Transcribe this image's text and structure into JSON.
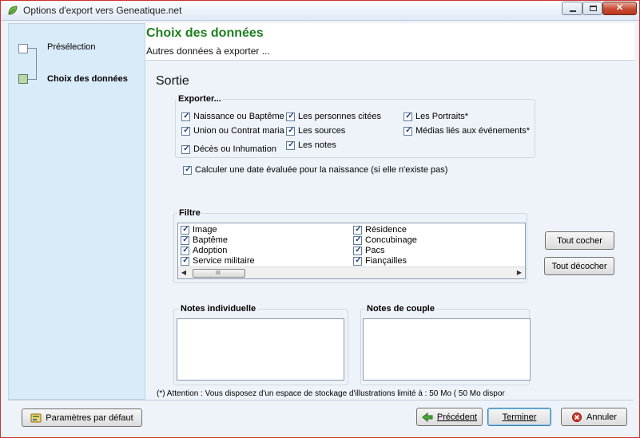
{
  "window": {
    "title": "Options d'export vers Geneatique.net",
    "controls": {
      "minimize": "minimize",
      "maximize": "maximize",
      "close": "✕"
    }
  },
  "sidebar": {
    "steps": [
      {
        "label": "Présélection",
        "active": false
      },
      {
        "label": "Choix des données",
        "active": true
      }
    ]
  },
  "header": {
    "title": "Choix des données",
    "subtitle": "Autres données à exporter ..."
  },
  "section": {
    "title": "Sortie"
  },
  "exporter": {
    "legend": "Exporter...",
    "items": [
      {
        "label": "Naissance ou Baptême",
        "checked": true
      },
      {
        "label": "Union ou Contrat maria",
        "checked": true
      },
      {
        "label": "Décès ou Inhumation",
        "checked": true
      },
      {
        "label": "Les personnes citées",
        "checked": true
      },
      {
        "label": "Les sources",
        "checked": true
      },
      {
        "label": "Les notes",
        "checked": true
      },
      {
        "label": "Les Portraits*",
        "checked": true
      },
      {
        "label": "Médias liés aux événements*",
        "checked": true
      }
    ],
    "calc_date": {
      "label": "Calculer une date évaluée pour la naissance (si elle n'existe pas)",
      "checked": true
    }
  },
  "filtre": {
    "legend": "Filtre",
    "items": [
      {
        "label": "Image",
        "checked": true
      },
      {
        "label": "Baptême",
        "checked": true
      },
      {
        "label": "Adoption",
        "checked": true
      },
      {
        "label": "Service militaire",
        "checked": true
      },
      {
        "label": "Résidence",
        "checked": true
      },
      {
        "label": "Concubinage",
        "checked": true
      },
      {
        "label": "Pacs",
        "checked": true
      },
      {
        "label": "Fiançailles",
        "checked": true
      }
    ],
    "scroll_grip": "III"
  },
  "buttons": {
    "tout_cocher": "Tout cocher",
    "tout_decocher": "Tout décocher",
    "parametres": "Paramètres par défaut",
    "precedent": "Précédent",
    "terminer": "Terminer",
    "annuler": "Annuler"
  },
  "notes": {
    "individuelle": "Notes individuelle",
    "couple": "Notes de couple"
  },
  "footnote": "(*) Attention : Vous disposez d'un espace de stockage d'illustrations limité  à :  50 Mo ( 50 Mo dispor",
  "colors": {
    "title_green": "#1d7f1d",
    "accent_blue": "#3c7fb1",
    "sidebar_bg": "#d9eaf8"
  }
}
